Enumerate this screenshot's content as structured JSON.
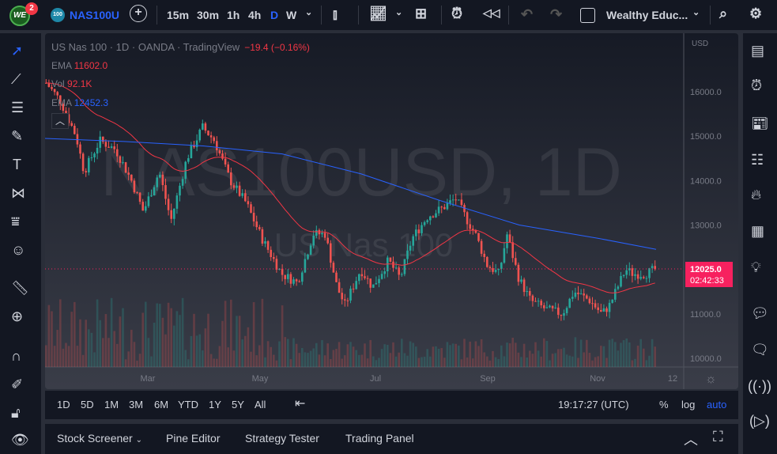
{
  "topbar": {
    "logo": "WE",
    "notifications": "2",
    "symbol_badge": "100",
    "symbol": "NAS100U",
    "intervals": [
      "15m",
      "30m",
      "1h",
      "4h",
      "D",
      "W"
    ],
    "active_interval": "D",
    "layout_name": "Wealthy Educ..."
  },
  "legend": {
    "title": "US Nas 100 · 1D · OANDA · TradingView",
    "change": "−19.4 (−0.16%)",
    "ema1_label": "EMA",
    "ema1_value": "11602.0",
    "vol_label": "Vol",
    "vol_value": "92.1K",
    "ema2_label": "EMA",
    "ema2_value": "12452.3"
  },
  "watermark": {
    "line1": "NAS100USD, 1D",
    "line2": "US Nas 100"
  },
  "price_axis": {
    "currency": "USD",
    "ticks": [
      "16000.0",
      "15000.0",
      "14000.0",
      "13000.0",
      "12000.0",
      "11000.0",
      "10000.0"
    ],
    "last_price": "12025.0",
    "countdown": "02:42:33"
  },
  "time_axis": {
    "ticks": [
      "Mar",
      "May",
      "Jul",
      "Sep",
      "Nov",
      "12"
    ]
  },
  "bottombar": {
    "ranges": [
      "1D",
      "5D",
      "1M",
      "3M",
      "6M",
      "YTD",
      "1Y",
      "5Y",
      "All"
    ],
    "clock": "19:17:27 (UTC)",
    "percent": "%",
    "log": "log",
    "auto": "auto"
  },
  "panel": {
    "tabs": [
      "Stock Screener",
      "Pine Editor",
      "Strategy Tester",
      "Trading Panel"
    ]
  },
  "colors": {
    "up": "#26a69a",
    "down": "#ef5350",
    "ema_fast": "#f23645",
    "ema_slow": "#2962ff",
    "accent": "#2962ff",
    "last": "#f7215f"
  },
  "chart_data": {
    "type": "candlestick",
    "ylim": [
      9800,
      16500
    ],
    "path": [
      [
        0,
        16200
      ],
      [
        18,
        15800
      ],
      [
        38,
        15000
      ],
      [
        48,
        14200
      ],
      [
        68,
        14900
      ],
      [
        88,
        14700
      ],
      [
        108,
        14000
      ],
      [
        123,
        13300
      ],
      [
        143,
        14200
      ],
      [
        158,
        13100
      ],
      [
        178,
        14500
      ],
      [
        198,
        15200
      ],
      [
        213,
        14900
      ],
      [
        233,
        14000
      ],
      [
        253,
        13500
      ],
      [
        273,
        12700
      ],
      [
        298,
        11900
      ],
      [
        318,
        11700
      ],
      [
        338,
        12800
      ],
      [
        353,
        12800
      ],
      [
        368,
        11600
      ],
      [
        378,
        11200
      ],
      [
        398,
        12000
      ],
      [
        413,
        11600
      ],
      [
        433,
        12200
      ],
      [
        448,
        11800
      ],
      [
        463,
        12700
      ],
      [
        483,
        13200
      ],
      [
        503,
        13400
      ],
      [
        518,
        13600
      ],
      [
        533,
        13100
      ],
      [
        543,
        12800
      ],
      [
        558,
        12100
      ],
      [
        573,
        11900
      ],
      [
        583,
        12800
      ],
      [
        598,
        11800
      ],
      [
        613,
        11300
      ],
      [
        633,
        11100
      ],
      [
        653,
        11000
      ],
      [
        668,
        11500
      ],
      [
        688,
        11300
      ],
      [
        703,
        11000
      ],
      [
        713,
        11200
      ],
      [
        723,
        11600
      ],
      [
        733,
        12000
      ],
      [
        743,
        11900
      ],
      [
        758,
        11900
      ],
      [
        773,
        12025
      ]
    ],
    "ema_slow": [
      [
        0,
        14950
      ],
      [
        100,
        14880
      ],
      [
        200,
        14780
      ],
      [
        300,
        14600
      ],
      [
        400,
        14150
      ],
      [
        500,
        13550
      ],
      [
        600,
        13000
      ],
      [
        700,
        12700
      ],
      [
        773,
        12452
      ]
    ]
  }
}
